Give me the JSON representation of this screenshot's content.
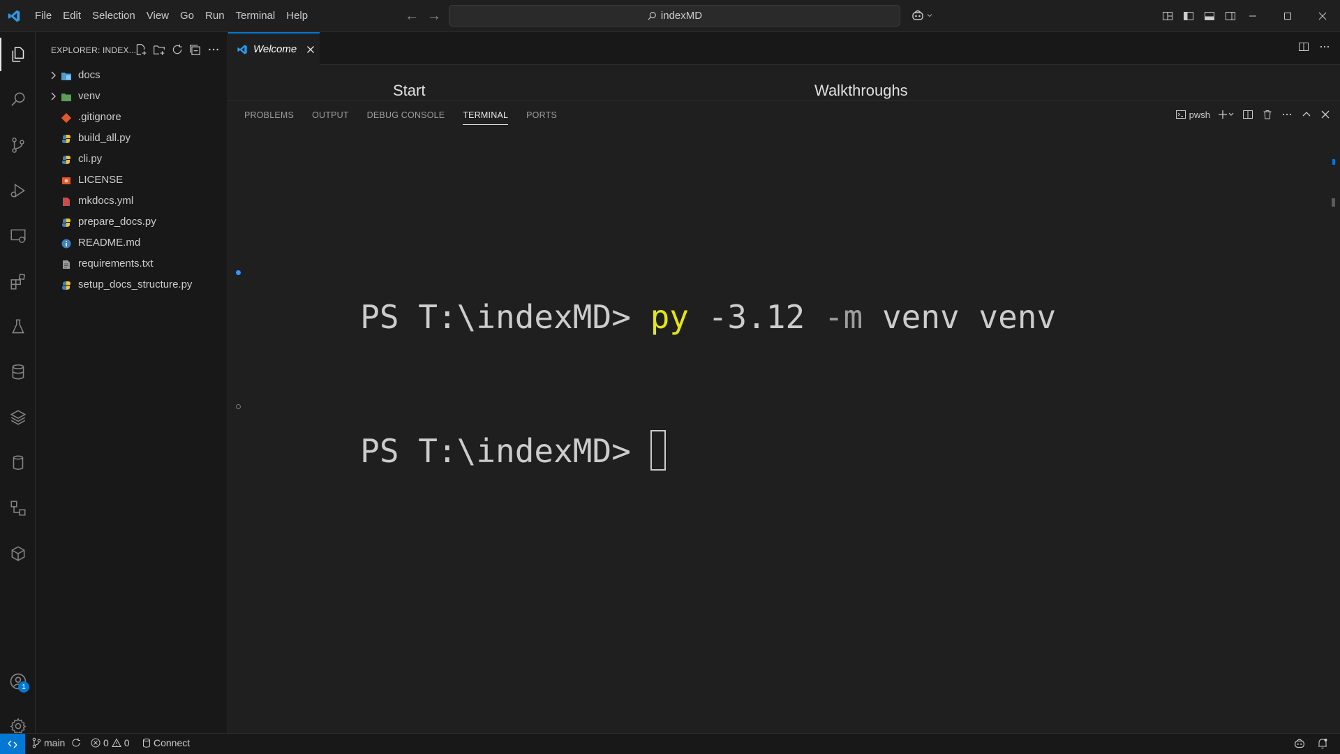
{
  "menu": [
    "File",
    "Edit",
    "Selection",
    "View",
    "Go",
    "Run",
    "Terminal",
    "Help"
  ],
  "search": {
    "text": "indexMD"
  },
  "explorer": {
    "title": "EXPLORER: INDEX..."
  },
  "files": [
    {
      "name": "docs",
      "type": "folder",
      "icon": "folder-docs-icon",
      "color": "#4b9cd3"
    },
    {
      "name": "venv",
      "type": "folder",
      "icon": "folder-venv-icon",
      "color": "#5a9e57"
    },
    {
      "name": ".gitignore",
      "type": "file",
      "icon": "git-icon",
      "color": "#e2572c"
    },
    {
      "name": "build_all.py",
      "type": "file",
      "icon": "python-icon",
      "color": "#3b82c4"
    },
    {
      "name": "cli.py",
      "type": "file",
      "icon": "python-icon",
      "color": "#3b82c4"
    },
    {
      "name": "LICENSE",
      "type": "file",
      "icon": "license-icon",
      "color": "#e2572c"
    },
    {
      "name": "mkdocs.yml",
      "type": "file",
      "icon": "yaml-icon",
      "color": "#d04a4a"
    },
    {
      "name": "prepare_docs.py",
      "type": "file",
      "icon": "python-icon",
      "color": "#3b82c4"
    },
    {
      "name": "README.md",
      "type": "file",
      "icon": "info-icon",
      "color": "#3b82c4"
    },
    {
      "name": "requirements.txt",
      "type": "file",
      "icon": "text-file-icon",
      "color": "#9a9a9a"
    },
    {
      "name": "setup_docs_structure.py",
      "type": "file",
      "icon": "python-icon",
      "color": "#3b82c4"
    }
  ],
  "editor": {
    "tab_label": "Welcome",
    "welcome_start": "Start",
    "welcome_walkthroughs": "Walkthroughs"
  },
  "panel": {
    "tabs": [
      "PROBLEMS",
      "OUTPUT",
      "DEBUG CONSOLE",
      "TERMINAL",
      "PORTS"
    ],
    "active_tab": "TERMINAL",
    "shell": "pwsh"
  },
  "terminal": {
    "line1": {
      "prompt": "PS T:\\indexMD> ",
      "cmd": "py",
      "arg1": " -3.12 ",
      "flag": "-m",
      "arg2": " venv venv"
    },
    "line2": {
      "prompt": "PS T:\\indexMD> "
    }
  },
  "status": {
    "branch": "main",
    "errors": "0",
    "warnings": "0",
    "connect": "Connect",
    "accounts_badge": "1"
  },
  "colors": {
    "accent": "#0078d4",
    "bg": "#1f1f1f",
    "sidebar_bg": "#181818",
    "terminal_cmd": "#e5e510"
  }
}
